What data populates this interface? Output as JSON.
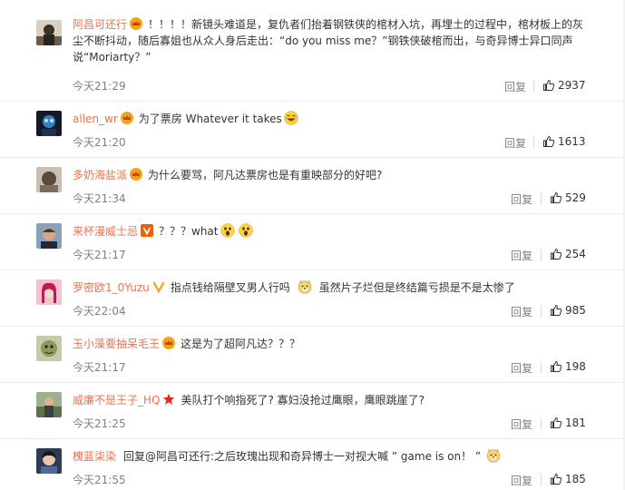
{
  "reply_label": "回复",
  "accent_color": "#eb7350",
  "comments": [
    {
      "username": "阿昌可还行",
      "badge": "crown-icon",
      "text": "！！！！新镜头难道是，复仇者们抬着钢铁侠的棺材入坑，再埋土的过程中，棺材板上的灰尘不断抖动，随后寡姐也从众人身后走出：“do you miss me？”钢铁侠破棺而出，与奇异博士异口同声说“Moriarty？”",
      "time": "今天21:29",
      "likes": "2937"
    },
    {
      "username": "allen_wr",
      "badge": "crown-icon",
      "text": "为了票房 Whatever it takes",
      "emoji": "laugh-emoji",
      "time": "今天21:20",
      "likes": "1613"
    },
    {
      "username": "多奶海盐派",
      "badge": "crown-icon",
      "text": "为什么要骂，阿凡达票房也是有重映部分的好吧?",
      "time": "今天21:34",
      "likes": "529"
    },
    {
      "username": "来杯漫威士忌",
      "badge": "v-badge-icon",
      "text": "？？？what",
      "emoji": "scream-emoji",
      "time": "今天21:17",
      "likes": "254"
    },
    {
      "username": "罗密欧1_0Yuzu",
      "badge": "v-yellow-icon",
      "text": "指点钱给隔壁叉男人行吗",
      "text2": "虽然片子烂但是终结篇亏损是不是太惨了",
      "emoji": "doge-emoji",
      "time": "今天22:04",
      "likes": "985"
    },
    {
      "username": "玉小藻要抽呆毛王",
      "badge": "crown-icon",
      "text": "这是为了超阿凡达？？？",
      "time": "今天21:17",
      "likes": "198"
    },
    {
      "username": "威廉不是王子_HQ",
      "badge": "star-icon",
      "text": "美队打个响指死了? 寡妇没抢过鹰眼，鹰眼跳崖了?",
      "time": "今天21:25",
      "likes": "181"
    },
    {
      "username": "槐蓝柒染",
      "text": "回复@阿昌可还行:之后玫瑰出现和奇异博士一对视大喊 ” game is on！ ”",
      "emoji": "doge-emoji",
      "time": "今天21:55",
      "likes": "185"
    }
  ]
}
